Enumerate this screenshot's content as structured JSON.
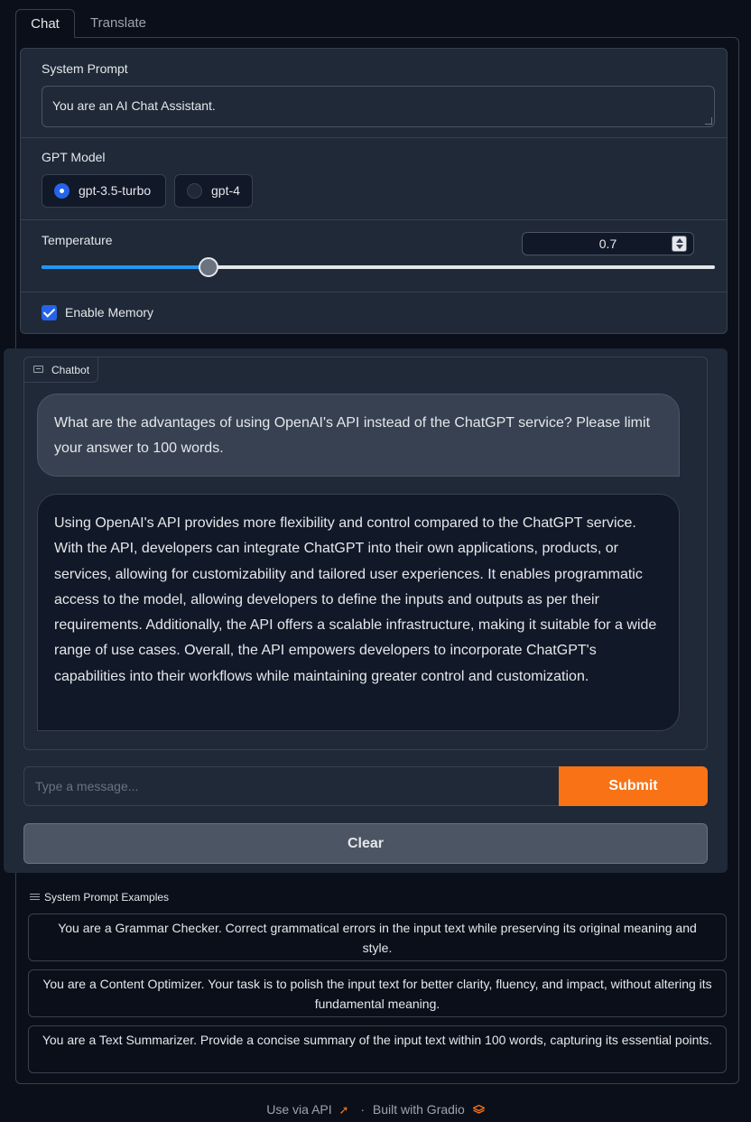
{
  "tabs": [
    "Chat",
    "Translate"
  ],
  "system_prompt": {
    "label": "System Prompt",
    "value": "You are an AI Chat Assistant."
  },
  "model": {
    "label": "GPT Model",
    "options": [
      "gpt-3.5-turbo",
      "gpt-4"
    ],
    "selected": "gpt-3.5-turbo"
  },
  "temperature": {
    "label": "Temperature",
    "value": "0.7",
    "min": 0,
    "max": 2
  },
  "memory": {
    "label": "Enable Memory",
    "checked": true
  },
  "chatbot": {
    "label": "Chatbot",
    "messages": [
      {
        "role": "user",
        "text": "What are the advantages of using OpenAI's API instead of the ChatGPT service? Please limit your answer to 100 words."
      },
      {
        "role": "assistant",
        "text": "Using OpenAI's API provides more flexibility and control compared to the ChatGPT service. With the API, developers can integrate ChatGPT into their own applications, products, or services, allowing for customizability and tailored user experiences. It enables programmatic access to the model, allowing developers to define the inputs and outputs as per their requirements. Additionally, the API offers a scalable infrastructure, making it suitable for a wide range of use cases. Overall, the API empowers developers to incorporate ChatGPT's capabilities into their workflows while maintaining greater control and customization."
      }
    ]
  },
  "input": {
    "placeholder": "Type a message...",
    "value": ""
  },
  "buttons": {
    "submit": "Submit",
    "clear": "Clear"
  },
  "examples": {
    "title": "System Prompt Examples",
    "items": [
      "You are a Grammar Checker. Correct grammatical errors in the input text while preserving its original meaning and style.",
      "You are a Content Optimizer. Your task is to polish the input text for better clarity, fluency, and impact, without altering its fundamental meaning.",
      "You are a Text Summarizer. Provide a concise summary of the input text within 100 words, capturing its essential points."
    ]
  },
  "footer": {
    "api": "Use via API",
    "separator": "·",
    "built": "Built with Gradio"
  },
  "colors": {
    "accent": "#f97316",
    "selected": "#2563eb",
    "slider": "#2196f3",
    "background": "#0b0f19",
    "panel": "#1f2937"
  }
}
